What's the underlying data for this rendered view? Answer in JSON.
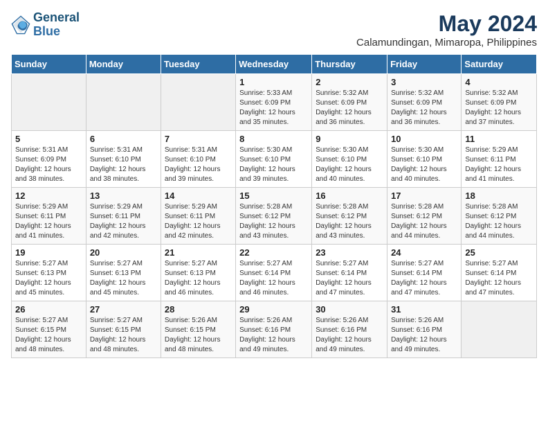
{
  "header": {
    "logo_line1": "General",
    "logo_line2": "Blue",
    "main_title": "May 2024",
    "subtitle": "Calamundingan, Mimaropa, Philippines"
  },
  "days_of_week": [
    "Sunday",
    "Monday",
    "Tuesday",
    "Wednesday",
    "Thursday",
    "Friday",
    "Saturday"
  ],
  "weeks": [
    [
      {
        "day": "",
        "empty": true
      },
      {
        "day": "",
        "empty": true
      },
      {
        "day": "",
        "empty": true
      },
      {
        "day": "1",
        "sunrise": "5:33 AM",
        "sunset": "6:09 PM",
        "daylight": "12 hours and 35 minutes."
      },
      {
        "day": "2",
        "sunrise": "5:32 AM",
        "sunset": "6:09 PM",
        "daylight": "12 hours and 36 minutes."
      },
      {
        "day": "3",
        "sunrise": "5:32 AM",
        "sunset": "6:09 PM",
        "daylight": "12 hours and 36 minutes."
      },
      {
        "day": "4",
        "sunrise": "5:32 AM",
        "sunset": "6:09 PM",
        "daylight": "12 hours and 37 minutes."
      }
    ],
    [
      {
        "day": "5",
        "sunrise": "5:31 AM",
        "sunset": "6:09 PM",
        "daylight": "12 hours and 38 minutes."
      },
      {
        "day": "6",
        "sunrise": "5:31 AM",
        "sunset": "6:10 PM",
        "daylight": "12 hours and 38 minutes."
      },
      {
        "day": "7",
        "sunrise": "5:31 AM",
        "sunset": "6:10 PM",
        "daylight": "12 hours and 39 minutes."
      },
      {
        "day": "8",
        "sunrise": "5:30 AM",
        "sunset": "6:10 PM",
        "daylight": "12 hours and 39 minutes."
      },
      {
        "day": "9",
        "sunrise": "5:30 AM",
        "sunset": "6:10 PM",
        "daylight": "12 hours and 40 minutes."
      },
      {
        "day": "10",
        "sunrise": "5:30 AM",
        "sunset": "6:10 PM",
        "daylight": "12 hours and 40 minutes."
      },
      {
        "day": "11",
        "sunrise": "5:29 AM",
        "sunset": "6:11 PM",
        "daylight": "12 hours and 41 minutes."
      }
    ],
    [
      {
        "day": "12",
        "sunrise": "5:29 AM",
        "sunset": "6:11 PM",
        "daylight": "12 hours and 41 minutes."
      },
      {
        "day": "13",
        "sunrise": "5:29 AM",
        "sunset": "6:11 PM",
        "daylight": "12 hours and 42 minutes."
      },
      {
        "day": "14",
        "sunrise": "5:29 AM",
        "sunset": "6:11 PM",
        "daylight": "12 hours and 42 minutes."
      },
      {
        "day": "15",
        "sunrise": "5:28 AM",
        "sunset": "6:12 PM",
        "daylight": "12 hours and 43 minutes."
      },
      {
        "day": "16",
        "sunrise": "5:28 AM",
        "sunset": "6:12 PM",
        "daylight": "12 hours and 43 minutes."
      },
      {
        "day": "17",
        "sunrise": "5:28 AM",
        "sunset": "6:12 PM",
        "daylight": "12 hours and 44 minutes."
      },
      {
        "day": "18",
        "sunrise": "5:28 AM",
        "sunset": "6:12 PM",
        "daylight": "12 hours and 44 minutes."
      }
    ],
    [
      {
        "day": "19",
        "sunrise": "5:27 AM",
        "sunset": "6:13 PM",
        "daylight": "12 hours and 45 minutes."
      },
      {
        "day": "20",
        "sunrise": "5:27 AM",
        "sunset": "6:13 PM",
        "daylight": "12 hours and 45 minutes."
      },
      {
        "day": "21",
        "sunrise": "5:27 AM",
        "sunset": "6:13 PM",
        "daylight": "12 hours and 46 minutes."
      },
      {
        "day": "22",
        "sunrise": "5:27 AM",
        "sunset": "6:14 PM",
        "daylight": "12 hours and 46 minutes."
      },
      {
        "day": "23",
        "sunrise": "5:27 AM",
        "sunset": "6:14 PM",
        "daylight": "12 hours and 47 minutes."
      },
      {
        "day": "24",
        "sunrise": "5:27 AM",
        "sunset": "6:14 PM",
        "daylight": "12 hours and 47 minutes."
      },
      {
        "day": "25",
        "sunrise": "5:27 AM",
        "sunset": "6:14 PM",
        "daylight": "12 hours and 47 minutes."
      }
    ],
    [
      {
        "day": "26",
        "sunrise": "5:27 AM",
        "sunset": "6:15 PM",
        "daylight": "12 hours and 48 minutes."
      },
      {
        "day": "27",
        "sunrise": "5:27 AM",
        "sunset": "6:15 PM",
        "daylight": "12 hours and 48 minutes."
      },
      {
        "day": "28",
        "sunrise": "5:26 AM",
        "sunset": "6:15 PM",
        "daylight": "12 hours and 48 minutes."
      },
      {
        "day": "29",
        "sunrise": "5:26 AM",
        "sunset": "6:16 PM",
        "daylight": "12 hours and 49 minutes."
      },
      {
        "day": "30",
        "sunrise": "5:26 AM",
        "sunset": "6:16 PM",
        "daylight": "12 hours and 49 minutes."
      },
      {
        "day": "31",
        "sunrise": "5:26 AM",
        "sunset": "6:16 PM",
        "daylight": "12 hours and 49 minutes."
      },
      {
        "day": "",
        "empty": true
      }
    ]
  ],
  "labels": {
    "sunrise": "Sunrise:",
    "sunset": "Sunset:",
    "daylight": "Daylight:"
  }
}
